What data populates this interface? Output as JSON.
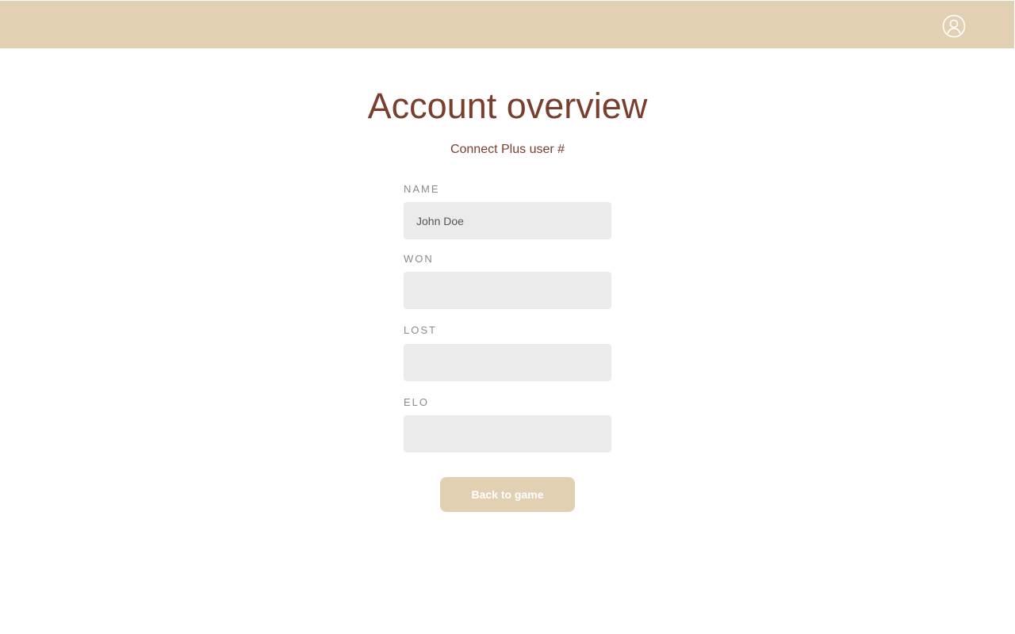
{
  "header": {
    "profile_icon": "user-circle-icon",
    "background": "#e2d0b3"
  },
  "page": {
    "title": "Account overview",
    "subtitle": "Connect Plus user #"
  },
  "form": {
    "name": {
      "label": "NAME",
      "value": "John Doe"
    },
    "won": {
      "label": "WON",
      "value": ""
    },
    "lost": {
      "label": "LOST",
      "value": ""
    },
    "elo": {
      "label": "ELO",
      "value": ""
    }
  },
  "actions": {
    "back_label": "Back to game"
  },
  "colors": {
    "accent": "#e2d0b3",
    "title": "#7a3e2e",
    "field_bg": "#ebebeb",
    "label": "#8a8a8a"
  }
}
